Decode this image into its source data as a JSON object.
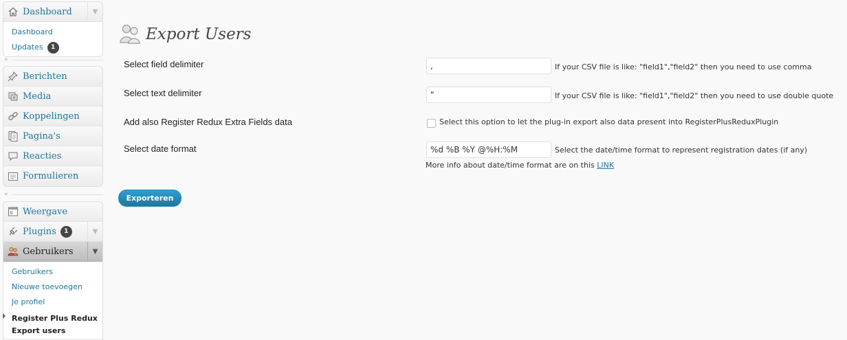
{
  "sidebar": {
    "dashboard": {
      "label": "Dashboard",
      "icon": "home-icon",
      "sub_items": [
        {
          "label": "Dashboard"
        },
        {
          "label": "Updates",
          "badge": "1"
        }
      ]
    },
    "content": [
      {
        "label": "Berichten",
        "icon": "pin-icon"
      },
      {
        "label": "Media",
        "icon": "media-icon"
      },
      {
        "label": "Koppelingen",
        "icon": "link-icon"
      },
      {
        "label": "Pagina's",
        "icon": "pages-icon"
      },
      {
        "label": "Reacties",
        "icon": "comments-icon"
      },
      {
        "label": "Formulieren",
        "icon": "forms-icon"
      }
    ],
    "admin": {
      "weergave": {
        "label": "Weergave",
        "icon": "appearance-icon"
      },
      "plugins": {
        "label": "Plugins",
        "icon": "plugin-icon",
        "badge": "1"
      },
      "gebruikers": {
        "label": "Gebruikers",
        "icon": "users-icon",
        "sub_items": [
          {
            "label": "Gebruikers"
          },
          {
            "label": "Nieuwe toevoegen"
          },
          {
            "label": "Je profiel"
          },
          {
            "label": "Register Plus Redux"
          },
          {
            "label": "Export users"
          }
        ]
      }
    }
  },
  "page": {
    "title": "Export Users",
    "icon": "users-icon",
    "fields": {
      "field_delimiter": {
        "label": "Select field delimiter",
        "value": ",",
        "hint": "If your CSV file is like: \"field1\",\"field2\" then you need to use comma"
      },
      "text_delimiter": {
        "label": "Select text delimiter",
        "value": "\"",
        "hint": "If your CSV file is like: \"field1\",\"field2\" then you need to use double quote"
      },
      "extra_fields": {
        "label": "Add also Register Redux Extra Fields data",
        "checked": false,
        "hint": "Select this option to let the plug-in export also data present into RegisterPlusReduxPlugin"
      },
      "date_format": {
        "label": "Select date format",
        "value": "%d %B %Y @%H:%M",
        "hint": "Select the date/time format to represent registration dates (if any)",
        "more_info": "More info about date/time format are on this",
        "more_info_link": "LINK"
      }
    },
    "submit_label": "Exporteren"
  },
  "colors": {
    "link": "#21759b",
    "button": "#21759b",
    "badge": "#464646",
    "background": "#f9f9f9"
  }
}
